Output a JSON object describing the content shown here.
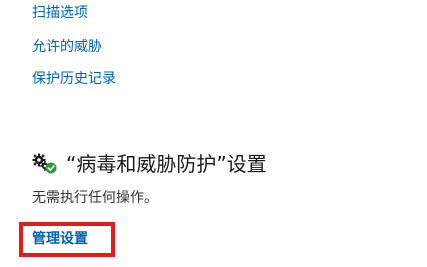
{
  "links": {
    "scan_options": "扫描选项",
    "allowed_threats": "允许的威胁",
    "protection_history": "保护历史记录"
  },
  "section": {
    "title": "“病毒和威胁防护”设置",
    "status": "无需执行任何操作。",
    "manage_link": "管理设置",
    "icon": "settings-gear-check-icon"
  },
  "colors": {
    "link": "#0063b1",
    "highlight": "#e21b1b",
    "check": "#2e9b3a"
  }
}
